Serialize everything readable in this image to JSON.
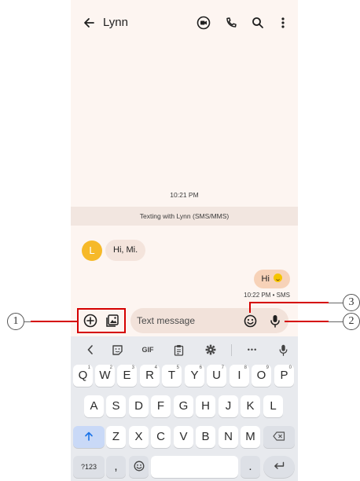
{
  "appbar": {
    "contact_name": "Lynn",
    "icons": [
      "arrow-back-icon",
      "video-call-icon",
      "phone-icon",
      "search-icon",
      "more-vert-icon"
    ]
  },
  "chat": {
    "timestamp_center": "10:21 PM",
    "info_banner": "Texting with Lynn (SMS/MMS)",
    "avatar_initial": "L",
    "avatar_color": "#f6b929",
    "incoming_message": "Hi, Mi.",
    "outgoing_message": "Hi",
    "outgoing_meta": "10:22 PM • SMS"
  },
  "compose": {
    "placeholder": "Text message",
    "icons": [
      "add-circle-icon",
      "gallery-icon",
      "emoji-icon",
      "microphone-icon"
    ]
  },
  "keyboard": {
    "toolbar": [
      "<",
      "sticker",
      "GIF",
      "clipboard",
      "settings",
      "•••",
      "mic"
    ],
    "gif_label": "GIF",
    "more_label": "•••",
    "row1": [
      {
        "key": "Q",
        "hint": "1"
      },
      {
        "key": "W",
        "hint": "2"
      },
      {
        "key": "E",
        "hint": "3"
      },
      {
        "key": "R",
        "hint": "4"
      },
      {
        "key": "T",
        "hint": "5"
      },
      {
        "key": "Y",
        "hint": "6"
      },
      {
        "key": "U",
        "hint": "7"
      },
      {
        "key": "I",
        "hint": "8"
      },
      {
        "key": "O",
        "hint": "9"
      },
      {
        "key": "P",
        "hint": "0"
      }
    ],
    "row2": [
      "A",
      "S",
      "D",
      "F",
      "G",
      "H",
      "J",
      "K",
      "L"
    ],
    "row3": [
      "Z",
      "X",
      "C",
      "V",
      "B",
      "N",
      "M"
    ],
    "symbols_key": "?123",
    "comma_key": ",",
    "period_key": "."
  },
  "annotations": {
    "labels": [
      "1",
      "2",
      "3"
    ],
    "color": "#d50000"
  }
}
